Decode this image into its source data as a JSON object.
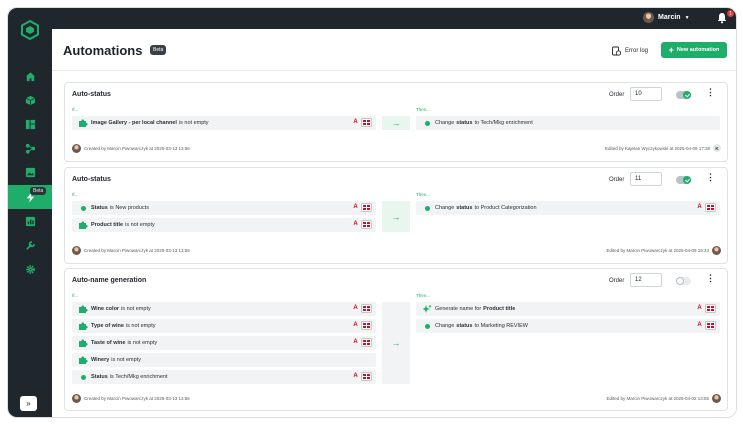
{
  "topbar": {
    "user_name": "Marcin",
    "notification_count": "1"
  },
  "sidebar": {
    "beta_label": "Beta",
    "expand_label": "»"
  },
  "page": {
    "title": "Automations",
    "beta_badge": "Beta",
    "error_log_label": "Error log",
    "new_automation_label": "New automation"
  },
  "labels": {
    "order": "Order",
    "if": "If...",
    "then": "Then..."
  },
  "cards": [
    {
      "title": "Auto-status",
      "order": "10",
      "enabled": true,
      "conditions": [
        {
          "icon": "puzzle-icon",
          "bold": "Image Gallery - per local channel",
          "text": "is not empty",
          "flags": true
        }
      ],
      "actions": [
        {
          "icon": "dot-icon",
          "pre": "Change",
          "bold": "status",
          "text": "to Tech/Mkg enrichment",
          "flags": false
        }
      ],
      "created": "Created by Marcin Piwowarczyk at 2025-03-13 13:56",
      "edited": "Edited by Kajetan Wyczykowski at 2025-04-09 17:38",
      "edited_badge": "K"
    },
    {
      "title": "Auto-status",
      "order": "11",
      "enabled": true,
      "conditions": [
        {
          "icon": "dot-icon",
          "bold": "Status",
          "text": "is New products",
          "flags": true
        },
        {
          "icon": "puzzle-icon",
          "bold": "Product title",
          "text": "is not empty",
          "flags": true
        }
      ],
      "actions": [
        {
          "icon": "dot-icon",
          "pre": "Change",
          "bold": "status",
          "text": "to Product Categorization",
          "flags": true
        }
      ],
      "created": "Created by Marcin Piwowarczyk at 2025-03-13 13:56",
      "edited": "Edited by Marcin Piwowarczyk at 2025-04-09 19:23"
    },
    {
      "title": "Auto-name generation",
      "order": "12",
      "enabled": false,
      "conditions": [
        {
          "icon": "puzzle-icon",
          "bold": "Wine color",
          "text": "is not empty",
          "flags": true
        },
        {
          "icon": "puzzle-icon",
          "bold": "Type of wine",
          "text": "is not empty",
          "flags": true
        },
        {
          "icon": "puzzle-icon",
          "bold": "Taste of wine",
          "text": "is not empty",
          "flags": true
        },
        {
          "icon": "puzzle-icon",
          "bold": "Winery",
          "text": "is not empty",
          "flags": false
        },
        {
          "icon": "dot-icon",
          "bold": "Status",
          "text": "is Tech/Mkg enrichment",
          "flags": true
        }
      ],
      "actions": [
        {
          "icon": "sparkle-icon",
          "pre": "Generate name for",
          "bold": "Product title",
          "text": "",
          "flags": true
        },
        {
          "icon": "dot-icon",
          "pre": "Change",
          "bold": "status",
          "text": "to Marketing REVIEW",
          "flags": true
        }
      ],
      "created": "Created by Marcin Piwowarczyk at 2025-03-13 13:56",
      "edited": "Edited by Marcin Piwowarczyk at 2025-04-02 13:56"
    }
  ],
  "colors": {
    "accent": "#1fae6a",
    "sidebar": "#1f272c"
  }
}
